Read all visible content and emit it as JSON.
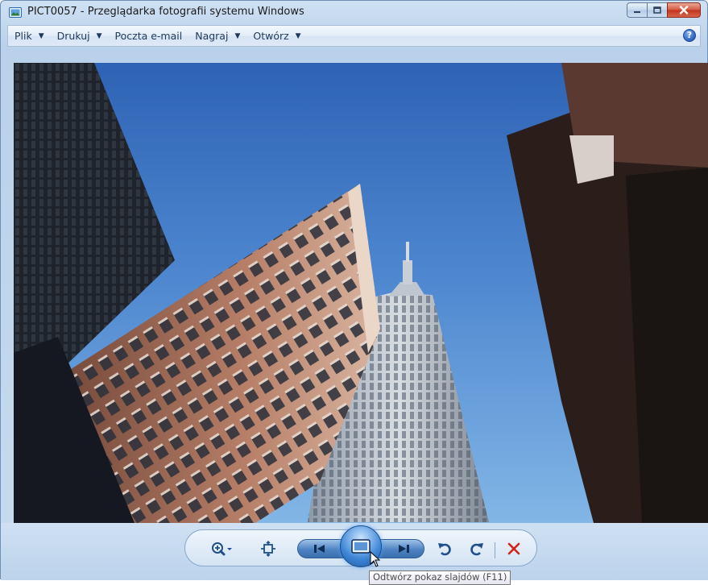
{
  "window": {
    "title": "PICT0057 - Przeglądarka fotografii systemu Windows",
    "icon": "photo-viewer-icon"
  },
  "caption_buttons": [
    {
      "name": "minimize",
      "icon": "minimize-icon"
    },
    {
      "name": "maximize",
      "icon": "maximize-icon"
    },
    {
      "name": "close",
      "icon": "close-icon"
    }
  ],
  "menu": {
    "items": [
      {
        "label": "Plik",
        "has_dropdown": true
      },
      {
        "label": "Drukuj",
        "has_dropdown": true
      },
      {
        "label": "Poczta e-mail",
        "has_dropdown": false
      },
      {
        "label": "Nagraj",
        "has_dropdown": true
      },
      {
        "label": "Otwórz",
        "has_dropdown": true
      }
    ],
    "help_label": "?"
  },
  "photo": {
    "description_icon": "skyscrapers-photo"
  },
  "controls": {
    "zoom_icon": "zoom-icon",
    "fit_icon": "actual-size-icon",
    "previous_icon": "previous-icon",
    "slideshow_icon": "slideshow-icon",
    "next_icon": "next-icon",
    "rotate_left_icon": "rotate-counterclockwise-icon",
    "rotate_right_icon": "rotate-clockwise-icon",
    "delete_icon": "delete-icon"
  },
  "tooltip": {
    "text": "Odtwórz pokaz slajdów (F11)"
  },
  "colors": {
    "accent": "#3d86d6",
    "delete_red": "#d0261b",
    "sky": "#4d86cf"
  }
}
